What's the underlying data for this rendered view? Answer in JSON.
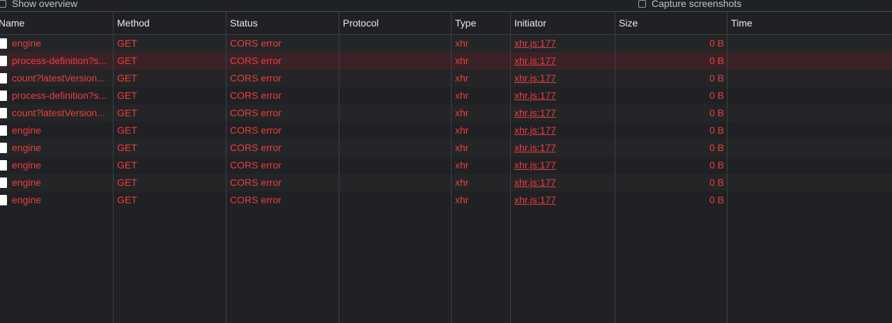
{
  "options": {
    "show_overview": "Show overview",
    "capture_screenshots": "Capture screenshots"
  },
  "columns": [
    "Name",
    "Method",
    "Status",
    "Protocol",
    "Type",
    "Initiator",
    "Size",
    "Time"
  ],
  "rows": [
    {
      "name": "engine",
      "method": "GET",
      "status": "CORS error",
      "protocol": "",
      "type": "xhr",
      "initiator": "xhr.js:177",
      "size": "0 B",
      "time": ""
    },
    {
      "name": "process-definition?s...",
      "method": "GET",
      "status": "CORS error",
      "protocol": "",
      "type": "xhr",
      "initiator": "xhr.js:177",
      "size": "0 B",
      "time": ""
    },
    {
      "name": "count?latestVersion...",
      "method": "GET",
      "status": "CORS error",
      "protocol": "",
      "type": "xhr",
      "initiator": "xhr.js:177",
      "size": "0 B",
      "time": ""
    },
    {
      "name": "process-definition?s...",
      "method": "GET",
      "status": "CORS error",
      "protocol": "",
      "type": "xhr",
      "initiator": "xhr.js:177",
      "size": "0 B",
      "time": ""
    },
    {
      "name": "count?latestVersion...",
      "method": "GET",
      "status": "CORS error",
      "protocol": "",
      "type": "xhr",
      "initiator": "xhr.js:177",
      "size": "0 B",
      "time": ""
    },
    {
      "name": "engine",
      "method": "GET",
      "status": "CORS error",
      "protocol": "",
      "type": "xhr",
      "initiator": "xhr.js:177",
      "size": "0 B",
      "time": ""
    },
    {
      "name": "engine",
      "method": "GET",
      "status": "CORS error",
      "protocol": "",
      "type": "xhr",
      "initiator": "xhr.js:177",
      "size": "0 B",
      "time": ""
    },
    {
      "name": "engine",
      "method": "GET",
      "status": "CORS error",
      "protocol": "",
      "type": "xhr",
      "initiator": "xhr.js:177",
      "size": "0 B",
      "time": ""
    },
    {
      "name": "engine",
      "method": "GET",
      "status": "CORS error",
      "protocol": "",
      "type": "xhr",
      "initiator": "xhr.js:177",
      "size": "0 B",
      "time": ""
    },
    {
      "name": "engine",
      "method": "GET",
      "status": "CORS error",
      "protocol": "",
      "type": "xhr",
      "initiator": "xhr.js:177",
      "size": "0 B",
      "time": ""
    }
  ],
  "selected_row": 1,
  "colors": {
    "background": "#202124",
    "error_text": "#ee3d3d",
    "selected_row": "#3a2227",
    "grid": "#3c4043"
  }
}
